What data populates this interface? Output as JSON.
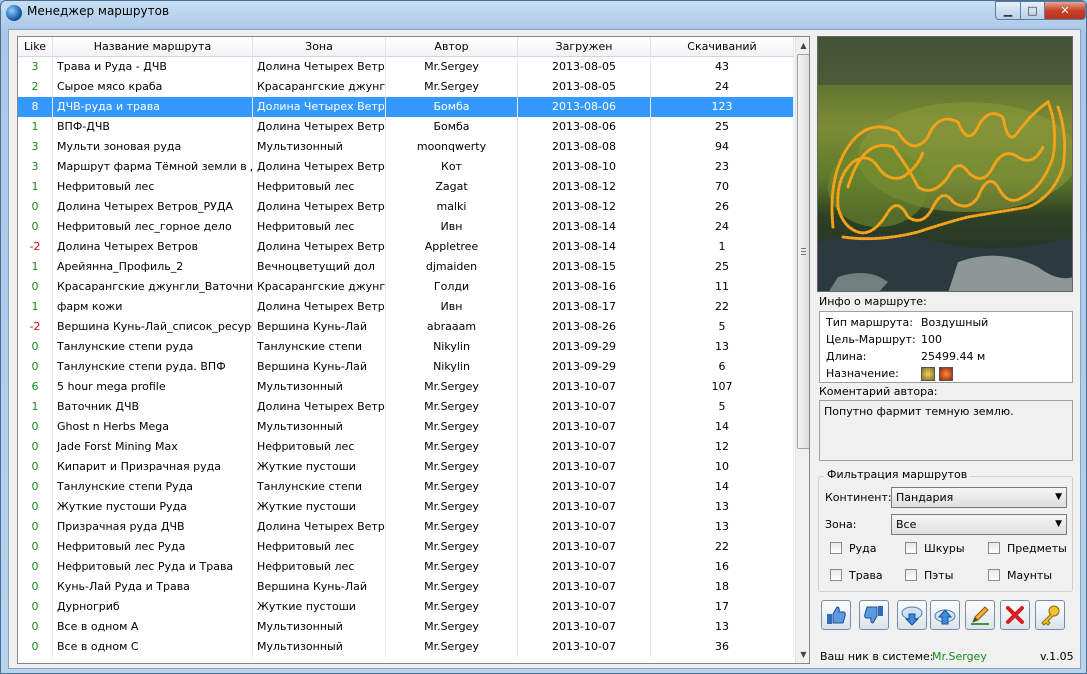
{
  "window": {
    "title": "Менеджер маршрутов",
    "min_glyph": "▁",
    "max_glyph": "□",
    "close_glyph": "✕"
  },
  "table": {
    "headers": [
      "Like",
      "Название маршрута",
      "Зона",
      "Автор",
      "Загружен",
      "Скачиваний"
    ],
    "selected_index": 2,
    "rows": [
      [
        "3",
        "Трава и Руда - ДЧВ",
        "Долина Четырех Ветров",
        "Mr.Sergey",
        "2013-08-05",
        "43"
      ],
      [
        "2",
        "Сырое мясо краба",
        "Красарангские джунгли",
        "Mr.Sergey",
        "2013-08-05",
        "24"
      ],
      [
        "8",
        "ДЧВ-руда и трава",
        "Долина Четырех Ветров",
        "Бомба",
        "2013-08-06",
        "123"
      ],
      [
        "1",
        "ВПФ-ДЧВ",
        "Долина Четырех Ветров",
        "Бомба",
        "2013-08-06",
        "25"
      ],
      [
        "3",
        "Мульти зоновая руда",
        "Мультизонный",
        "moonqwerty",
        "2013-08-08",
        "94"
      ],
      [
        "3",
        "Маршрут фарма Тёмной земли в Д...",
        "Долина Четырех Ветров",
        "Кот",
        "2013-08-10",
        "23"
      ],
      [
        "1",
        "Нефритовый лес",
        "Нефритовый лес",
        "Zagat",
        "2013-08-12",
        "70"
      ],
      [
        "0",
        "Долина Четырех Ветров_РУДА",
        "Долина Четырех Ветров",
        "malki",
        "2013-08-12",
        "26"
      ],
      [
        "0",
        "Нефритовый лес_горное дело",
        "Нефритовый лес",
        "Ивн",
        "2013-08-14",
        "24"
      ],
      [
        "-2",
        "Долина Четырех Ветров",
        "Долина Четырех Ветров",
        "Appletree",
        "2013-08-14",
        "1"
      ],
      [
        "1",
        "Арейянна_Профиль_2",
        "Вечноцветущий дол",
        "djmaiden",
        "2013-08-15",
        "25"
      ],
      [
        "0",
        "Красарангские джунгли_Ваточник",
        "Красарангские джунгли",
        "Голди",
        "2013-08-16",
        "11"
      ],
      [
        "1",
        "фарм кожи",
        "Долина Четырех Ветров",
        "Ивн",
        "2013-08-17",
        "22"
      ],
      [
        "-2",
        "Вершина Кунь-Лай_список_ресурсов",
        "Вершина Кунь-Лай",
        "abraaam",
        "2013-08-26",
        "5"
      ],
      [
        "0",
        "Танлунские степи руда",
        "Танлунские степи",
        "Nikylin",
        "2013-09-29",
        "13"
      ],
      [
        "0",
        "Танлунские степи руда. ВПФ",
        "Вершина Кунь-Лай",
        "Nikylin",
        "2013-09-29",
        "6"
      ],
      [
        "6",
        "5 hour mega profile",
        "Мультизонный",
        "Mr.Sergey",
        "2013-10-07",
        "107"
      ],
      [
        "1",
        "Ваточник ДЧВ",
        "Долина Четырех Ветров",
        "Mr.Sergey",
        "2013-10-07",
        "5"
      ],
      [
        "0",
        "Ghost n Herbs Mega",
        "Мультизонный",
        "Mr.Sergey",
        "2013-10-07",
        "14"
      ],
      [
        "0",
        "Jade Forst Mining Max",
        "Нефритовый лес",
        "Mr.Sergey",
        "2013-10-07",
        "12"
      ],
      [
        "0",
        "Кипарит и Призрачная руда",
        "Жуткие пустоши",
        "Mr.Sergey",
        "2013-10-07",
        "10"
      ],
      [
        "0",
        "Танлунские степи Руда",
        "Танлунские степи",
        "Mr.Sergey",
        "2013-10-07",
        "14"
      ],
      [
        "0",
        "Жуткие пустоши Руда",
        "Жуткие пустоши",
        "Mr.Sergey",
        "2013-10-07",
        "13"
      ],
      [
        "0",
        "Призрачная руда ДЧВ",
        "Долина Четырех Ветров",
        "Mr.Sergey",
        "2013-10-07",
        "13"
      ],
      [
        "0",
        "Нефритовый лес Руда",
        "Нефритовый лес",
        "Mr.Sergey",
        "2013-10-07",
        "22"
      ],
      [
        "0",
        "Нефритовый лес Руда и Трава",
        "Нефритовый лес",
        "Mr.Sergey",
        "2013-10-07",
        "16"
      ],
      [
        "0",
        "Кунь-Лай Руда и Трава",
        "Вершина Кунь-Лай",
        "Mr.Sergey",
        "2013-10-07",
        "18"
      ],
      [
        "0",
        "Дурногриб",
        "Жуткие пустоши",
        "Mr.Sergey",
        "2013-10-07",
        "17"
      ],
      [
        "0",
        "Все в одном А",
        "Мультизонный",
        "Mr.Sergey",
        "2013-10-07",
        "13"
      ],
      [
        "0",
        "Все в одном С",
        "Мультизонный",
        "Mr.Sergey",
        "2013-10-07",
        "36"
      ]
    ]
  },
  "info": {
    "label": "Инфо о маршруте:",
    "type_label": "Тип маршрута:",
    "type_value": "Воздушный",
    "target_label": "Цель-Маршрут:",
    "target_value": "100",
    "length_label": "Длина:",
    "length_value": "25499.44 м",
    "purpose_label": "Назначение:"
  },
  "comment": {
    "label": "Коментарий автора:",
    "text": "Попутно фармит темную землю."
  },
  "filter": {
    "title": "Фильтрация маршрутов",
    "continent_label": "Континент:",
    "continent_value": "Пандария",
    "zone_label": "Зона:",
    "zone_value": "Все",
    "checkboxes": [
      "Руда",
      "Шкуры",
      "Предметы",
      "Трава",
      "Пэты",
      "Маунты"
    ]
  },
  "footer": {
    "nick_label": "Ваш ник в системе:",
    "nick_value": "Mr.Sergey",
    "version": "v.1.05"
  },
  "colors": {
    "selection": "#3399ff",
    "positive": "#1a8a1a",
    "negative": "#d01010",
    "nick": "#1a8a1a"
  }
}
